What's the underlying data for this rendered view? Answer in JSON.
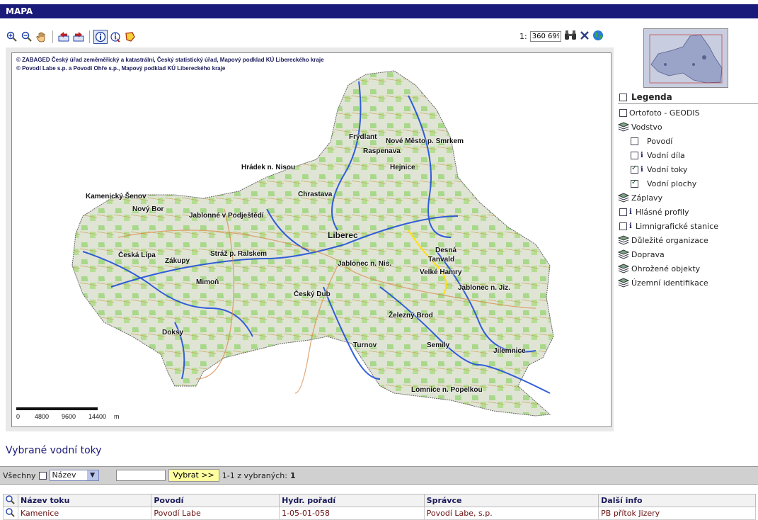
{
  "window": {
    "title": "MAPA"
  },
  "scale": {
    "prefix": "1:",
    "value": "360 699"
  },
  "map": {
    "copyright_lines": [
      "© ZABAGED Český úřad zeměměřický a katastrální, Český statistický úřad, Mapový podklad KÚ Libereckého kraje",
      "© Povodí Labe s.p. a Povodí Ohře s.p., Mapový podklad KÚ Libereckého kraje"
    ],
    "cities": [
      "Frýdlant",
      "Nové Město p. Smrkem",
      "Raspenava",
      "Hejnice",
      "Hrádek n. Nisou",
      "Chrastava",
      "Kamenický Šenov",
      "Nový Bor",
      "Jablonné v Podještědí",
      "Liberec",
      "Česká Lípa",
      "Stráž p. Ralskem",
      "Desná",
      "Tanvald",
      "Zákupy",
      "Jablonec n. Nis.",
      "Velké Hamry",
      "Mimoň",
      "Jablonec n. Jiz.",
      "Český Dub",
      "Železný Brod",
      "Doksy",
      "Turnov",
      "Semily",
      "Jilemnice",
      "Lomnice n. Popelkou"
    ],
    "scalebar_labels": [
      "0",
      "4800",
      "9600",
      "14400",
      "m"
    ]
  },
  "legend": {
    "title": "Legenda",
    "items": [
      {
        "label": "Ortofoto - GEODIS"
      },
      {
        "label": "Vodstvo"
      },
      {
        "label": "Povodí"
      },
      {
        "label": "Vodní díla"
      },
      {
        "label": "Vodní toky"
      },
      {
        "label": "Vodní plochy"
      },
      {
        "label": "Záplavy"
      },
      {
        "label": "Hlásné profily"
      },
      {
        "label": "Limnigrafické stanice"
      },
      {
        "label": "Důležité organizace"
      },
      {
        "label": "Doprava"
      },
      {
        "label": "Ohrožené objekty"
      },
      {
        "label": "Územní identifikace"
      }
    ]
  },
  "results": {
    "title": "Vybrané vodní toky",
    "filter": {
      "all_label": "Všechny",
      "sort_value": "Název",
      "select_button": "Vybrat >>",
      "count_prefix": "1-1 z vybraných:",
      "count": "1"
    },
    "columns": [
      "Název toku",
      "Povodí",
      "Hydr. pořadí",
      "Správce",
      "Další info"
    ],
    "rows": [
      [
        "Kamenice",
        "Povodí Labe",
        "1-05-01-058",
        "Povodí Labe, s.p.",
        "PB přítok Jizery"
      ]
    ]
  },
  "colors": {
    "title_bar": "#1a1a7a",
    "button_yellow": "#ffffa0",
    "river_blue": "#1f4fd8"
  }
}
